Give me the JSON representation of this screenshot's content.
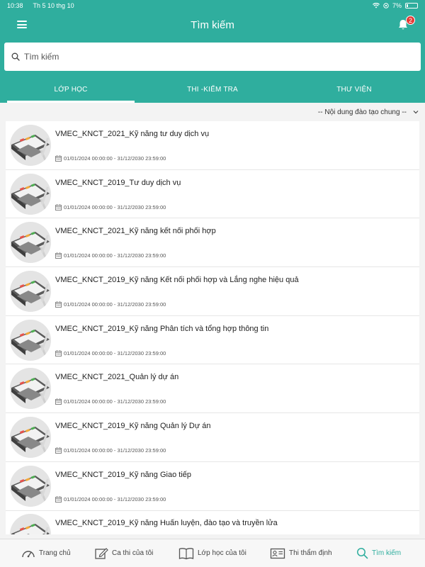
{
  "status_bar": {
    "time": "10:38",
    "date": "Th 5 10 thg 10",
    "battery": "7%"
  },
  "header": {
    "title": "Tìm kiếm",
    "notification_count": "2"
  },
  "search": {
    "placeholder": "Tìm kiếm",
    "value": ""
  },
  "tabs": [
    {
      "label": "LỚP HỌC",
      "active": true
    },
    {
      "label": "THI -KIỂM TRA",
      "active": false
    },
    {
      "label": "THƯ VIỆN",
      "active": false
    }
  ],
  "filter": {
    "selected": "-- Nội dung đào tạo chung --"
  },
  "courses": [
    {
      "title": "VMEC_KNCT_2021_Kỹ năng tư duy dịch vụ",
      "date": "01/01/2024 00:00:00 - 31/12/2030 23:59:00"
    },
    {
      "title": "VMEC_KNCT_2019_Tư duy dịch vụ",
      "date": "01/01/2024 00:00:00 - 31/12/2030 23:59:00"
    },
    {
      "title": "VMEC_KNCT_2021_Kỹ năng kết nối phối hợp",
      "date": "01/01/2024 00:00:00 - 31/12/2030 23:59:00"
    },
    {
      "title": "VMEC_KNCT_2019_Kỹ năng Kết nối phối hợp và Lắng nghe hiệu quả",
      "date": "01/01/2024 00:00:00 - 31/12/2030 23:59:00"
    },
    {
      "title": "VMEC_KNCT_2019_Kỹ năng Phân tích và tổng hợp thông tin",
      "date": "01/01/2024 00:00:00 - 31/12/2030 23:59:00"
    },
    {
      "title": "VMEC_KNCT_2021_Quản lý dự án",
      "date": "01/01/2024 00:00:00 - 31/12/2030 23:59:00"
    },
    {
      "title": "VMEC_KNCT_2019_Kỹ năng Quản lý Dự án",
      "date": "01/01/2024 00:00:00 - 31/12/2030 23:59:00"
    },
    {
      "title": "VMEC_KNCT_2019_Kỹ năng Giao tiếp",
      "date": "01/01/2024 00:00:00 - 31/12/2030 23:59:00"
    },
    {
      "title": "VMEC_KNCT_2019_Kỹ năng Huấn luyện, đào tạo và truyền lửa",
      "date": ""
    }
  ],
  "bottom_nav": [
    {
      "label": "Trang chủ",
      "icon": "speedometer-icon",
      "active": false
    },
    {
      "label": "Ca thi của tôi",
      "icon": "edit-icon",
      "active": false
    },
    {
      "label": "Lớp học của tôi",
      "icon": "book-icon",
      "active": false
    },
    {
      "label": "Thi thẩm định",
      "icon": "id-card-icon",
      "active": false
    },
    {
      "label": "Tìm kiếm",
      "icon": "search-icon",
      "active": true
    }
  ],
  "colors": {
    "primary": "#2fae9e",
    "badge": "#e53935"
  }
}
